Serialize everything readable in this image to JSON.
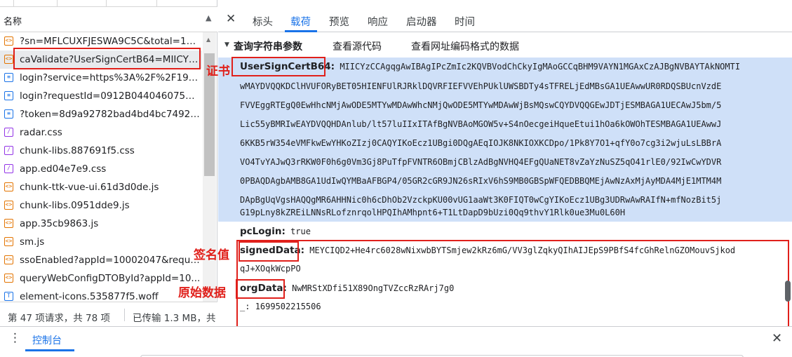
{
  "left": {
    "header_label": "名称",
    "requests": [
      {
        "name": "?sn=MFLCUXFJESWA9C5C&total=1&...",
        "type": "xhr"
      },
      {
        "name": "caValidate?UserSignCertB64=MIICYz...",
        "type": "xhr"
      },
      {
        "name": "login?service=https%3A%2F%2F19.1...",
        "type": "doc"
      },
      {
        "name": "login?requestId=0912B04404607592...",
        "type": "doc"
      },
      {
        "name": "?token=8d9a92782bad4bd4bc7492b...",
        "type": "doc"
      },
      {
        "name": "radar.css",
        "type": "css"
      },
      {
        "name": "chunk-libs.887691f5.css",
        "type": "css"
      },
      {
        "name": "app.ed04e7e9.css",
        "type": "css"
      },
      {
        "name": "chunk-ttk-vue-ui.61d3d0de.js",
        "type": "js"
      },
      {
        "name": "chunk-libs.0951dde9.js",
        "type": "js"
      },
      {
        "name": "app.35cb9863.js",
        "type": "js"
      },
      {
        "name": "sm.js",
        "type": "js"
      },
      {
        "name": "ssoEnabled?appId=10002047&reque...",
        "type": "xhr"
      },
      {
        "name": "queryWebConfigDTOById?appId=10...",
        "type": "xhr"
      },
      {
        "name": "element-icons.535877f5.woff",
        "type": "font"
      }
    ],
    "status": {
      "requests": "第 47 项请求，共 78 项",
      "transferred": "已传输 1.3 MB，共"
    }
  },
  "tabs": {
    "labels": [
      "标头",
      "载荷",
      "预览",
      "响应",
      "启动器",
      "时间"
    ],
    "active": "载荷"
  },
  "payload": {
    "section_title": "查询字符串参数",
    "view_source": "查看源代码",
    "view_url_encoded": "查看网址编码格式的数据",
    "cert_key": "UserSignCertB64:",
    "cert_lines": [
      "MIICYzCCAgqgAwIBAgIPcZmIc2KQVBVodChCkyIgMAoGCCqBHM9VAYN1MGAxCzAJBgNVBAYTAkNOMTI",
      "wMAYDVQQKDClHVUFORyBET05HIENFUlRJRklDQVRFIEFVVEhPUklUWSBDTy4sTFRELjEdMBsGA1UEAwwUR0RDQSBUcnVzdE",
      "FVVEggRTEgQ0EwHhcNMjAwODE5MTYwMDAwWhcNMjQwODE5MTYwMDAwWjBsMQswCQYDVQQGEwJDTjESMBAGA1UECAwJ5bm/5",
      "Lic55yBMRIwEAYDVQQHDAnlub/lt57luIIxITAfBgNVBAoMGOW5v+S4nOecgeiHqueEtui1hOa6kOWOhTESMBAGA1UEAwwJ",
      "6KKB5rW354eVMFkwEwYHKoZIzj0CAQYIKoEcz1UBgi0DQgAEqIOJK8NKIOXKCDpo/1Pk8Y7O1+qfY0o7cg3i2wjuLsLBBrA",
      "VO4TvYAJwQ3rRKW0F0h6g0Vm3Gj8PuTfpFVNTR6OBmjCBlzAdBgNVHQ4EFgQUaNET8vZaYzNuSZ5qO41rlE0/92IwCwYDVR",
      "0PBAQDAgbAMB8GA1UdIwQYMBaAFBGP4/05GR2cGR9JN26sRIxV6hS9MB0GBSpWFQEDBBQMEjAwNzAxMjAyMDA4MjE1MTM4M",
      "DApBgUqVgsHAQQgMR6AHHNic0h6cDhOb2VzckpKU00vUG1aaWt3K0FIQT0wCgYIKoEcz1UBg3UDRwAwRAIfN+mfNozBit5j",
      "G19pLny8kZREiLNNsRLofznrqolHPQIhAMhpnt6+T1LtDapD9bUzi0Qq9thvY1Rlk0ue3Mu0L60H"
    ],
    "pc_login_key": "pcLogin:",
    "pc_login_value": "true",
    "signed_key": "signedData:",
    "signed_lines": [
      "MEYCIQD2+He4rc6028wNixwbBYTSmjew2kRz6mG/VV3glZqkyQIhAIJEpS9PBfS4fcGhRelnGZOMouvSjkod",
      "qJ+XOqkWcpPO"
    ],
    "org_key": "orgData:",
    "org_value": "NwMRStXDfi51X89OngTVZccRzRArj7g0",
    "underscore_key": "_:",
    "underscore_value": "1699502215506"
  },
  "annotations": {
    "cert": "证书",
    "signed": "签名值",
    "org": "原始数据"
  },
  "drawer": {
    "console_label": "控制台"
  },
  "colors": {
    "accent": "#1a73e8",
    "highlight": "#cfe0f8",
    "annotation_red": "#e0201b"
  }
}
